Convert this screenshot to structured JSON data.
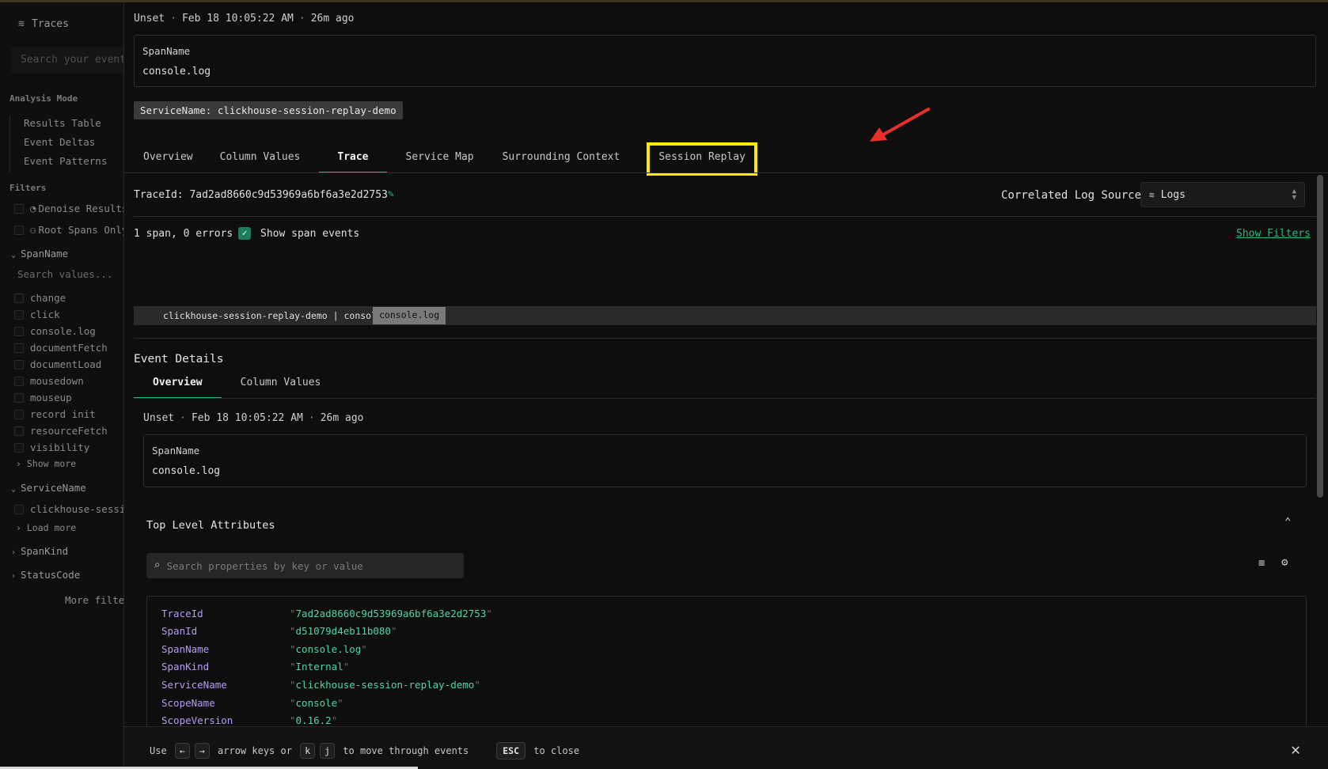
{
  "sidebar": {
    "title": "Traces",
    "search_placeholder": "Search your events",
    "analysis_mode_label": "Analysis Mode",
    "modes": [
      "Results Table",
      "Event Deltas",
      "Event Patterns"
    ],
    "filters_label": "Filters",
    "denoise_label": "Denoise Results",
    "root_spans_label": "Root Spans Only",
    "spanname_group": "SpanName",
    "search_values_placeholder": "Search values...",
    "span_values": [
      "change",
      "click",
      "console.log",
      "documentFetch",
      "documentLoad",
      "mousedown",
      "mouseup",
      "record init",
      "resourceFetch",
      "visibility"
    ],
    "show_more": "Show more",
    "servicename_group": "ServiceName",
    "service_values": [
      "clickhouse-session-replay-demo"
    ],
    "load_more": "Load more",
    "spankind_group": "SpanKind",
    "statuscode_group": "StatusCode",
    "more_filters": "More filters"
  },
  "drawer": {
    "header": {
      "status": "Unset",
      "timestamp": "Feb 18 10:05:22 AM",
      "relative": "26m ago",
      "field_key": "SpanName",
      "field_value": "console.log",
      "service_chip": "ServiceName: clickhouse-session-replay-demo"
    },
    "tabs": [
      "Overview",
      "Column Values",
      "Trace",
      "Service Map",
      "Surrounding Context",
      "Session Replay"
    ],
    "active_tab": "Trace",
    "highlighted_tab": "Session Replay",
    "trace": {
      "trace_id_label": "TraceId: 7ad2ad8660c9d53969a6bf6a3e2d2753",
      "correlated_label": "Correlated Log Source",
      "log_source": "Logs",
      "summary": "1 span, 0 errors",
      "show_span_events": "Show span events",
      "show_span_events_checked": true,
      "show_filters": "Show Filters",
      "waterfall_label": "clickhouse-session-replay-demo | console",
      "waterfall_span": "console.log"
    },
    "event_details": {
      "title": "Event Details",
      "tabs": [
        "Overview",
        "Column Values"
      ],
      "active_tab": "Overview",
      "status": "Unset",
      "timestamp": "Feb 18 10:05:22 AM",
      "relative": "26m ago",
      "field_key": "SpanName",
      "field_value": "console.log",
      "top_level_title": "Top Level Attributes",
      "search_placeholder": "Search properties by key or value",
      "attributes": [
        {
          "key": "TraceId",
          "value": "7ad2ad8660c9d53969a6bf6a3e2d2753"
        },
        {
          "key": "SpanId",
          "value": "d51079d4eb11b080"
        },
        {
          "key": "SpanName",
          "value": "console.log"
        },
        {
          "key": "SpanKind",
          "value": "Internal"
        },
        {
          "key": "ServiceName",
          "value": "clickhouse-session-replay-demo"
        },
        {
          "key": "ScopeName",
          "value": "console"
        },
        {
          "key": "ScopeVersion",
          "value": "0.16.2"
        }
      ]
    },
    "footer": {
      "use": "Use",
      "key_left": "←",
      "key_right": "→",
      "arrow_keys_or": "arrow keys or",
      "key_k": "k",
      "key_j": "j",
      "move_text": "to move through events",
      "key_esc": "ESC",
      "close_text": "to close"
    }
  },
  "colors": {
    "accent": "#2fb58b",
    "highlight": "#ffeb00",
    "annotation_arrow": "#e8302a",
    "attr_key": "#b59cf0",
    "attr_value": "#4fd6a7"
  }
}
